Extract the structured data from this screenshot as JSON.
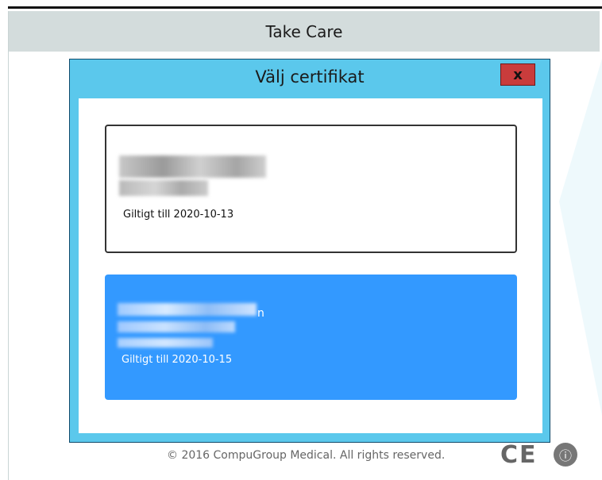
{
  "outer_window": {
    "title": "Take Care"
  },
  "dialog": {
    "title": "Välj certifikat",
    "close_label": "x",
    "certificates": [
      {
        "valid_text": "Giltigt till 2020-10-13",
        "selected": false
      },
      {
        "name_visible_tail": "n",
        "valid_text": "Giltigt till 2020-10-15",
        "selected": true
      }
    ]
  },
  "footer": {
    "copyright": "© 2016 CompuGroup Medical. All rights reserved.",
    "ce_mark": "CE",
    "medical_icon": "ⓘ"
  },
  "colors": {
    "dialog_frame": "#5bc8ec",
    "selected_card": "#3399ff",
    "close_button": "#c93c3c",
    "outer_titlebar": "#d3dcdc"
  },
  "icons": [
    "close-icon",
    "ce-mark-icon",
    "medical-icon"
  ]
}
